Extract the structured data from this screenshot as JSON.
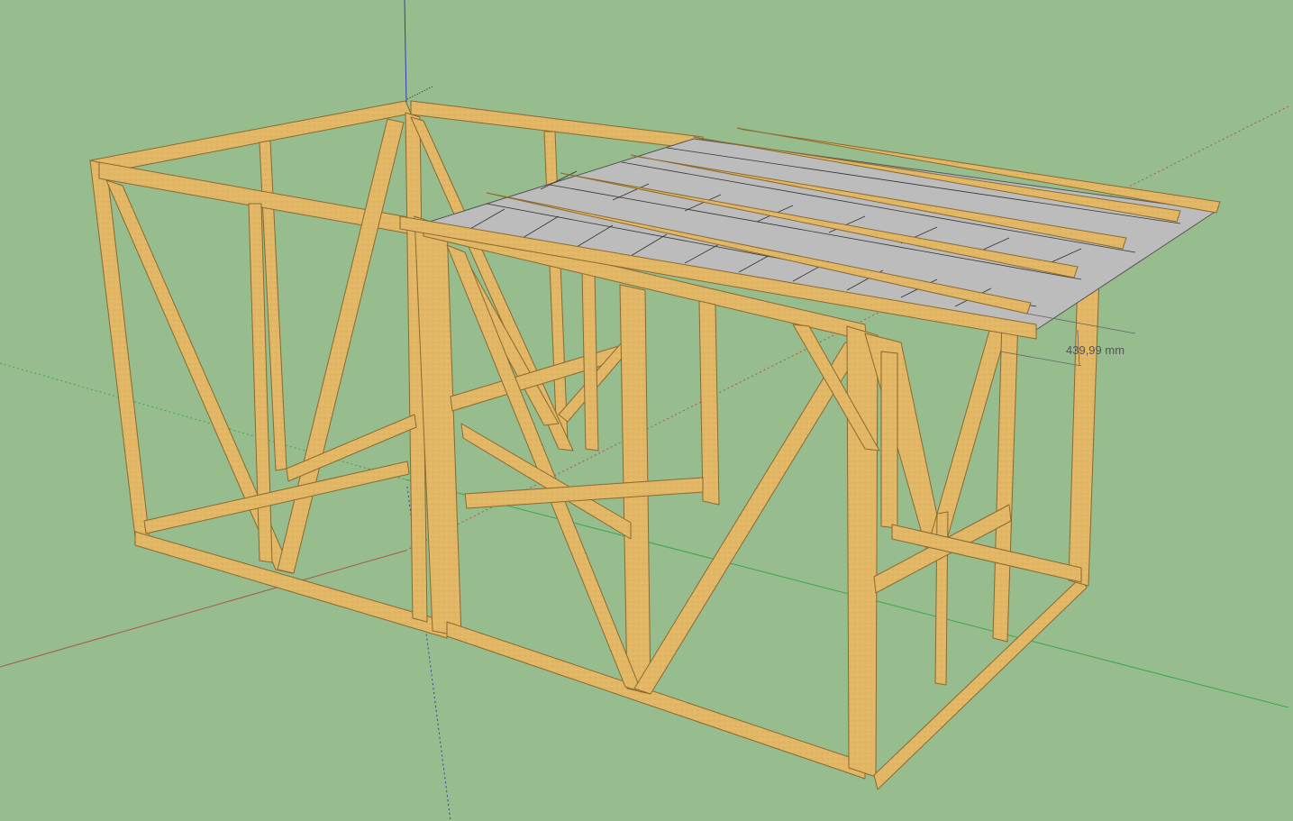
{
  "viewport": {
    "background": "#97bc8e",
    "wood_color": "#e2b766",
    "roof_color": "#bcbcbc",
    "axis_colors": {
      "red": "#a35a4a",
      "green": "#3aa84a",
      "blue": "#3a3ab0"
    }
  },
  "dimension": {
    "label": "439,99 mm"
  }
}
